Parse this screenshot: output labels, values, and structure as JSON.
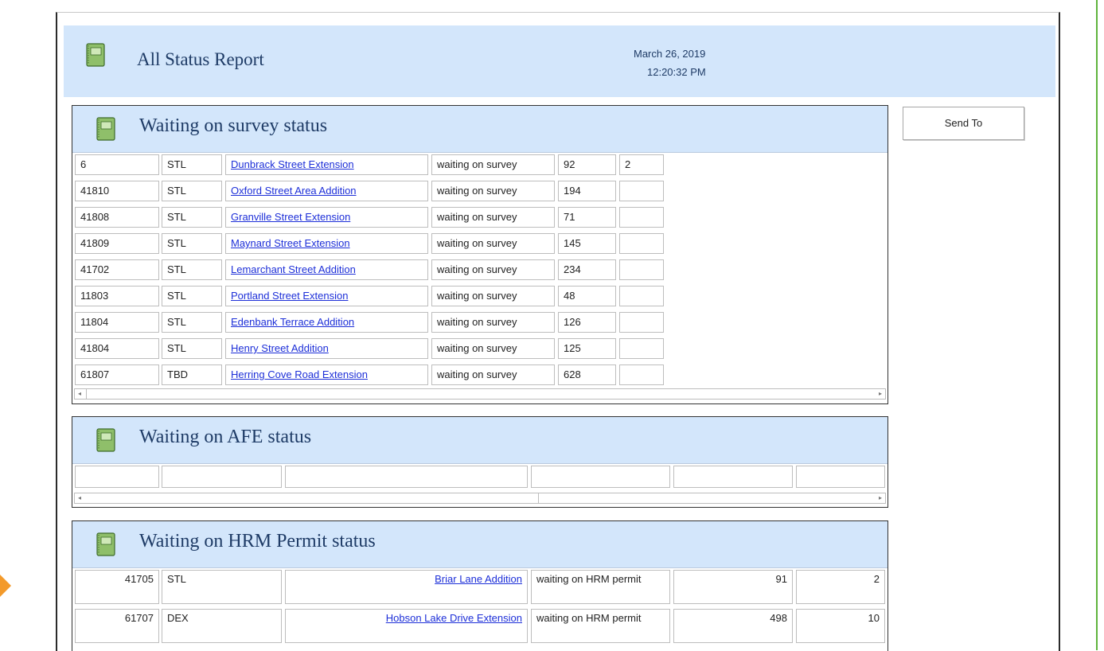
{
  "report": {
    "title": "All Status Report",
    "date": "March 26, 2019",
    "time": "12:20:32 PM"
  },
  "send_to_label": "Send To",
  "icons": {
    "book": "notebook-icon",
    "left": "scroll-left-icon",
    "right": "scroll-right-icon"
  },
  "colors": {
    "header_bg": "#d3e6fb",
    "title_text": "#1e3b66",
    "link": "#1d2fd8",
    "window_edge": "#5fb33c",
    "arrow": "#f39a2b"
  },
  "survey": {
    "title": "Waiting on survey status",
    "rows": [
      [
        "6",
        "STL",
        "Dunbrack Street Extension",
        "waiting on survey",
        "92",
        "2"
      ],
      [
        "41810",
        "STL",
        "Oxford Street Area Addition",
        "waiting on survey",
        "194",
        ""
      ],
      [
        "41808",
        "STL",
        "Granville Street Extension",
        "waiting on survey",
        "71",
        ""
      ],
      [
        "41809",
        "STL",
        "Maynard Street Extension",
        "waiting on survey",
        "145",
        ""
      ],
      [
        "41702",
        "STL",
        "Lemarchant Street Addition",
        "waiting on survey",
        "234",
        ""
      ],
      [
        "11803",
        "STL",
        "Portland Street Extension",
        "waiting on survey",
        "48",
        ""
      ],
      [
        "11804",
        "STL",
        "Edenbank Terrace Addition",
        "waiting on survey",
        "126",
        ""
      ],
      [
        "41804",
        "STL",
        "Henry Street Addition",
        "waiting on survey",
        "125",
        ""
      ],
      [
        "61807",
        "TBD",
        "Herring Cove Road Extension",
        "waiting on survey",
        "628",
        ""
      ]
    ]
  },
  "afe": {
    "title": "Waiting on AFE status",
    "rows": [
      [
        "",
        "",
        "",
        "",
        "",
        ""
      ]
    ]
  },
  "hrm": {
    "title": "Waiting on HRM Permit status",
    "rows": [
      [
        "41705",
        "STL",
        "Briar Lane Addition",
        "waiting on HRM permit",
        "91",
        "2"
      ],
      [
        "61707",
        "DEX",
        "Hobson Lake Drive Extension",
        "waiting on HRM permit",
        "498",
        "10"
      ]
    ]
  }
}
